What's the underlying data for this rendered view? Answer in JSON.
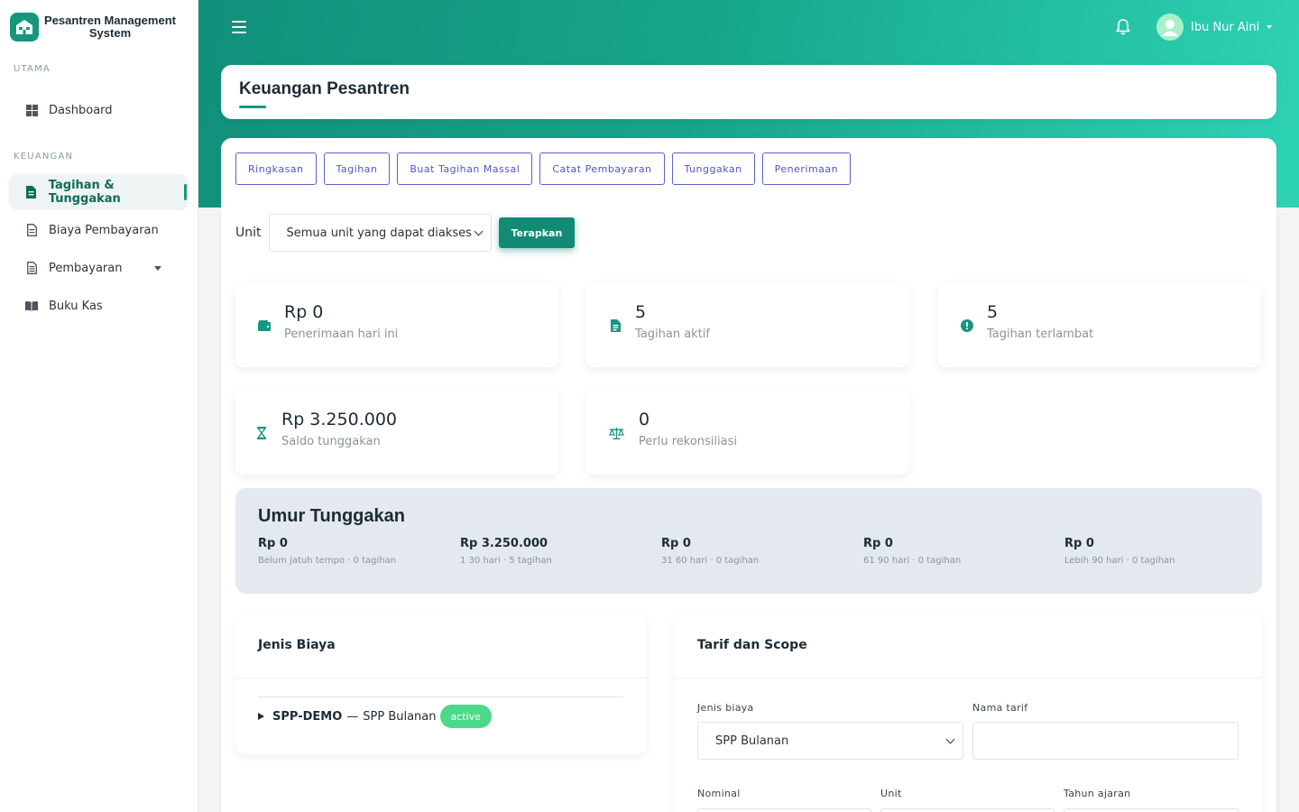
{
  "app": {
    "name": "Pesantren Management System"
  },
  "sidebar": {
    "sections": [
      {
        "label": "UTAMA",
        "items": [
          {
            "label": "Dashboard",
            "icon": "grid-icon"
          }
        ]
      },
      {
        "label": "KEUANGAN",
        "items": [
          {
            "label": "Tagihan & Tunggakan",
            "icon": "file-invoice-icon",
            "active": true
          },
          {
            "label": "Biaya Pembayaran",
            "icon": "file-icon"
          },
          {
            "label": "Pembayaran",
            "icon": "receipt-icon",
            "has_submenu": true
          },
          {
            "label": "Buku Kas",
            "icon": "book-icon"
          }
        ]
      }
    ]
  },
  "header": {
    "user_name": "Ibu Nur Aini"
  },
  "page": {
    "title": "Keuangan Pesantren"
  },
  "tabs": [
    "Ringkasan",
    "Tagihan",
    "Buat Tagihan Massal",
    "Catat Pembayaran",
    "Tunggakan",
    "Penerimaan"
  ],
  "filter": {
    "label": "Unit",
    "selected": "Semua unit yang dapat diakses",
    "apply_label": "Terapkan"
  },
  "stats": [
    {
      "value": "Rp 0",
      "label": "Penerimaan hari ini",
      "icon": "wallet-icon"
    },
    {
      "value": "5",
      "label": "Tagihan aktif",
      "icon": "invoice-icon"
    },
    {
      "value": "5",
      "label": "Tagihan terlambat",
      "icon": "alert-circle-icon"
    },
    {
      "value": "Rp 3.250.000",
      "label": "Saldo tunggakan",
      "icon": "hourglass-icon"
    },
    {
      "value": "0",
      "label": "Perlu rekonsiliasi",
      "icon": "scale-icon"
    }
  ],
  "aging": {
    "title": "Umur Tunggakan",
    "buckets": [
      {
        "amount": "Rp 0",
        "desc": "Belum jatuh tempo · 0 tagihan"
      },
      {
        "amount": "Rp 3.250.000",
        "desc": "1 30 hari · 5 tagihan"
      },
      {
        "amount": "Rp 0",
        "desc": "31 60 hari · 0 tagihan"
      },
      {
        "amount": "Rp 0",
        "desc": "61 90 hari · 0 tagihan"
      },
      {
        "amount": "Rp 0",
        "desc": "Lebih 90 hari · 0 tagihan"
      }
    ]
  },
  "fee_types": {
    "title": "Jenis Biaya",
    "items": [
      {
        "code": "SPP-DEMO",
        "separator": "—",
        "name": "SPP Bulanan",
        "status": "active"
      }
    ]
  },
  "tariff": {
    "title": "Tarif dan Scope",
    "fee_type_label": "Jenis biaya",
    "fee_type_value": "SPP Bulanan",
    "name_label": "Nama tarif",
    "name_value": "",
    "nominal_label": "Nominal",
    "unit_label": "Unit",
    "year_label": "Tahun ajaran"
  },
  "colors": {
    "primary": "#17967e",
    "tab_outline": "#5b63c7",
    "badge_active": "#4cd98a",
    "aging_bg": "#e3e9ee"
  }
}
